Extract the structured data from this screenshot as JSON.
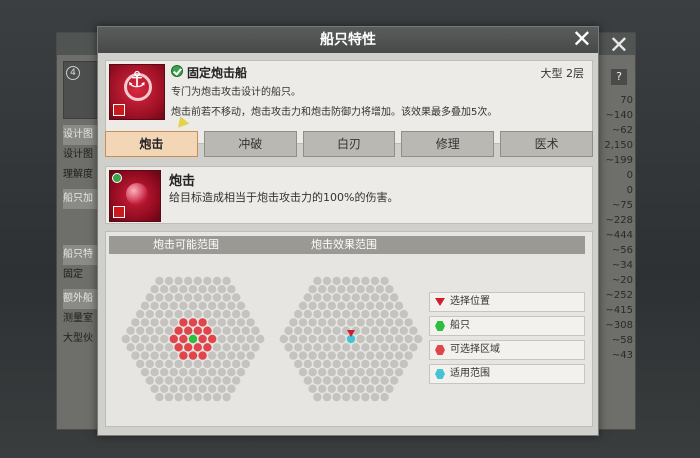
{
  "background": {
    "level": "4",
    "left_labels": [
      "设计图",
      "设计图",
      "理解度",
      "船只加",
      "船只特",
      "固定",
      "额外船",
      "测量室",
      "大型伙"
    ],
    "right_values": [
      "70",
      "~140",
      "~62",
      "2,150",
      "~199",
      "0",
      "0",
      "~75",
      "~228",
      "~444",
      "~56",
      "~34",
      "~20",
      "~252",
      "~415",
      "~308",
      "~58",
      "~43"
    ],
    "help": "?"
  },
  "dialog": {
    "title": "船只特性",
    "close": "✕",
    "ship": {
      "name": "固定炮击船",
      "size": "大型 2层",
      "desc_line1": "专门为炮击攻击设计的船只。",
      "desc_line2": "炮击前若不移动，炮击攻击力和炮击防御力将增加。该效果最多叠加5次。"
    },
    "tabs": [
      {
        "label": "炮击",
        "active": true
      },
      {
        "label": "冲破",
        "active": false
      },
      {
        "label": "白刃",
        "active": false
      },
      {
        "label": "修理",
        "active": false
      },
      {
        "label": "医术",
        "active": false
      }
    ],
    "skill": {
      "name": "炮击",
      "desc": "给目标造成相当于炮击攻击力的100%的伤害。"
    },
    "range": {
      "header_possible": "炮击可能范围",
      "header_effect": "炮击效果范围",
      "legend": [
        {
          "label": "选择位置",
          "marker": "triangle",
          "color": "#d21e2a"
        },
        {
          "label": "船只",
          "marker": "hex",
          "color": "#2bbf3b"
        },
        {
          "label": "可选择区域",
          "marker": "hex",
          "color": "#e0454c"
        },
        {
          "label": "适用范围",
          "marker": "hex",
          "color": "#45c4d6"
        }
      ],
      "grid_radius": 7,
      "possible_red_ring_radii": [
        1,
        2
      ],
      "effect_center_marked": true
    }
  },
  "colors": {
    "hex_empty": "#c4c3bf",
    "hex_red": "#e0454c",
    "hex_green": "#2bbf3b",
    "hex_cyan": "#45c4d6",
    "tab_active": "#f2d6b6"
  }
}
